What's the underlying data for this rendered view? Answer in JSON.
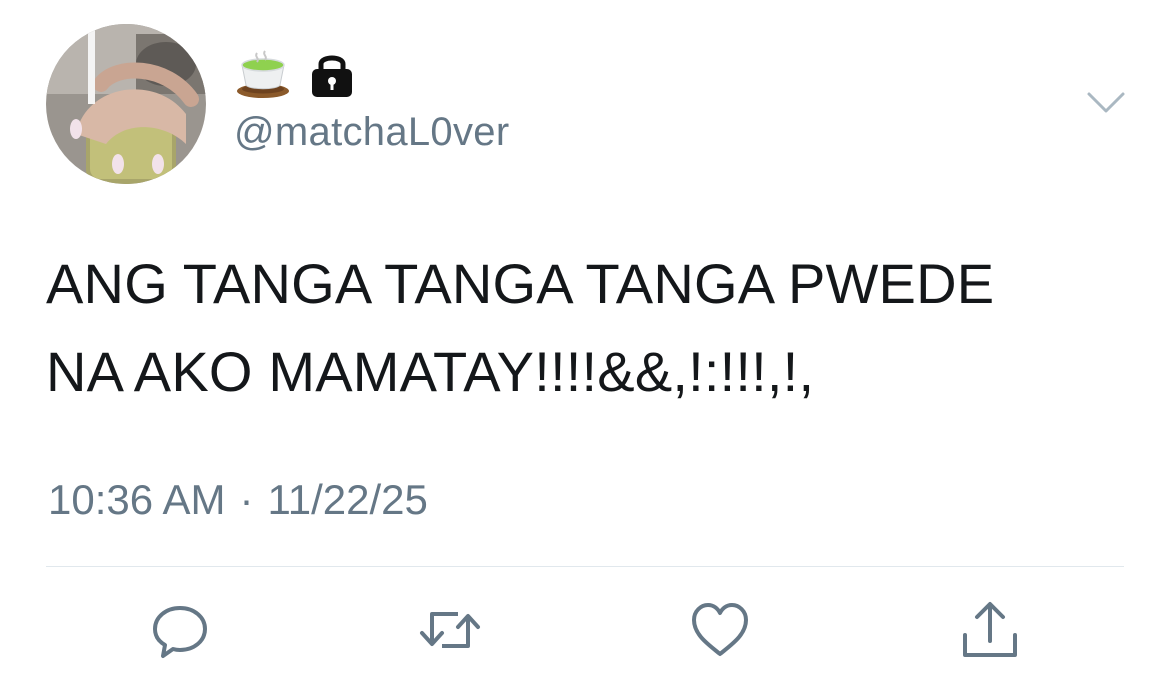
{
  "tweet": {
    "handle": "@matchaL0ver",
    "display_name_emojis": [
      "tea-icon",
      "lock-icon"
    ],
    "text_line_1": "ANG TANGA TANGA TANGA PWEDE",
    "text_line_2": "NA AKO MAMATAY!!!!&&,!:!!!,!,",
    "time": "10:36 AM",
    "separator": "·",
    "date": "11/22/25"
  },
  "actions": [
    {
      "icon": "reply-icon"
    },
    {
      "icon": "retweet-icon"
    },
    {
      "icon": "like-icon"
    },
    {
      "icon": "share-icon"
    }
  ],
  "colors": {
    "text": "#14171a",
    "secondary": "#657786",
    "icon": "#657786",
    "divider": "#e1e8ed",
    "tea_green": "#8fd14f"
  }
}
